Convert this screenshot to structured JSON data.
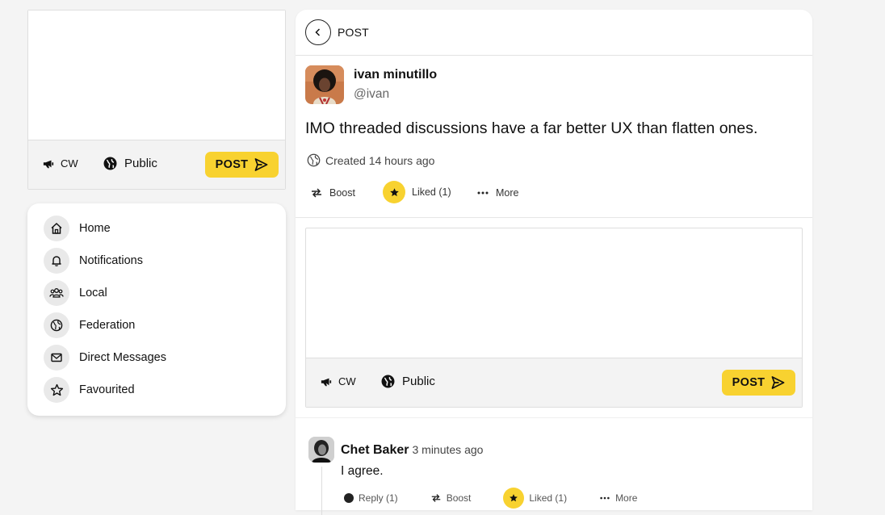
{
  "left_composer": {
    "cw_label": "CW",
    "visibility_label": "Public",
    "post_label": "POST"
  },
  "nav": {
    "items": [
      {
        "label": "Home",
        "icon": "home-icon"
      },
      {
        "label": "Notifications",
        "icon": "bell-icon"
      },
      {
        "label": "Local",
        "icon": "users-icon"
      },
      {
        "label": "Federation",
        "icon": "globe-icon"
      },
      {
        "label": "Direct Messages",
        "icon": "envelope-icon"
      },
      {
        "label": "Favourited",
        "icon": "star-icon"
      }
    ]
  },
  "header": {
    "title": "POST"
  },
  "post": {
    "author_name": "ivan minutillo",
    "author_handle": "@ivan",
    "body": "IMO threaded discussions have a far better UX than flatten ones.",
    "created": "Created 14 hours ago",
    "boost_label": "Boost",
    "liked_label": "Liked (1)",
    "more_label": "More"
  },
  "reply_composer": {
    "cw_label": "CW",
    "visibility_label": "Public",
    "post_label": "POST"
  },
  "reply": {
    "author_name": "Chet Baker",
    "time": "3 minutes ago",
    "body": "I agree.",
    "reply_label": "Reply (1)",
    "boost_label": "Boost",
    "liked_label": "Liked (1)",
    "more_label": "More"
  },
  "colors": {
    "accent": "#f8d230",
    "background": "#f4f4f4"
  }
}
